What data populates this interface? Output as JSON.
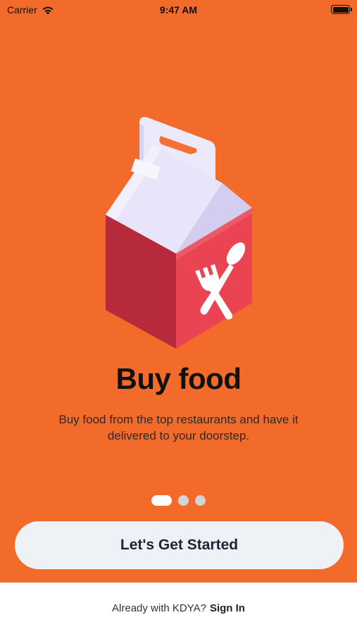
{
  "status_bar": {
    "carrier": "Carrier",
    "time": "9:47 AM",
    "wifi_icon": "wifi-icon",
    "battery_icon": "battery-icon"
  },
  "colors": {
    "hero_background": "#f26b2a",
    "button_background": "#eef1f6",
    "box_red": "#e8424f",
    "box_lid": "#e4e0f5"
  },
  "onboarding": {
    "illustration_icon": "food-delivery-box-icon",
    "title": "Buy food",
    "description": "Buy food from the top restaurants and have it delivered to your doorstep.",
    "page_count": 3,
    "active_page": 1
  },
  "cta": {
    "label": "Let's Get Started"
  },
  "footer": {
    "prompt": "Already with KDYA?",
    "signin_label": "Sign In"
  }
}
